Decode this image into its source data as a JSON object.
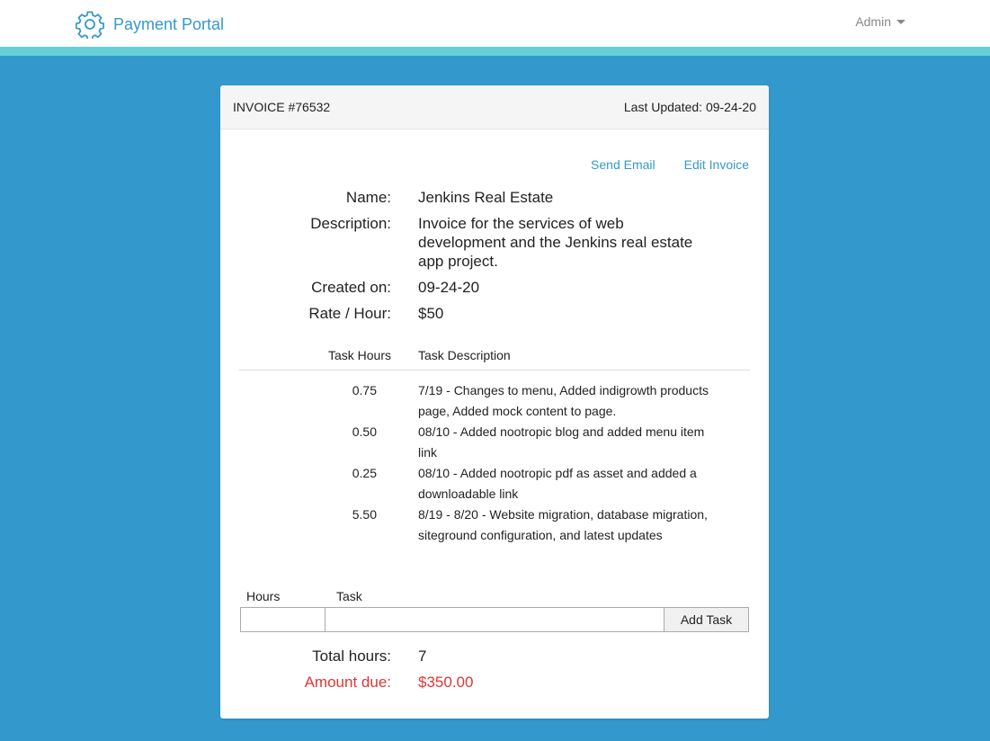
{
  "nav": {
    "brand": "Payment Portal",
    "user_menu": "Admin"
  },
  "invoice": {
    "number": "INVOICE #76532",
    "last_updated": "Last Updated: 09-24-20",
    "actions": {
      "send_email": "Send Email",
      "edit_invoice": "Edit Invoice"
    },
    "details": {
      "name_label": "Name:",
      "name_value": "Jenkins Real Estate",
      "description_label": "Description:",
      "description_value": "Invoice for the services of web development and the Jenkins real estate app project.",
      "created_label": "Created on:",
      "created_value": "09-24-20",
      "rate_label": "Rate / Hour:",
      "rate_value": "$50"
    },
    "tasks_header": {
      "hours": "Task Hours",
      "description": "Task Description"
    },
    "tasks": [
      {
        "hours": "0.75",
        "description": "7/19 - Changes to menu, Added indigrowth products page, Added mock content to page."
      },
      {
        "hours": "0.50",
        "description": "08/10 - Added nootropic blog and added menu item link"
      },
      {
        "hours": "0.25",
        "description": "08/10 - Added nootropic pdf as asset and added a downloadable link"
      },
      {
        "hours": "5.50",
        "description": "8/19 - 8/20 - Website migration, database migration, siteground configuration, and latest updates"
      }
    ],
    "new_task": {
      "hours_label": "Hours",
      "task_label": "Task",
      "hours_value": "",
      "task_value": "",
      "add_button": "Add Task"
    },
    "totals": {
      "hours_label": "Total hours:",
      "hours_value": "7",
      "due_label": "Amount due:",
      "due_value": "$350.00"
    }
  },
  "colors": {
    "background": "#3399cc",
    "accent_stripe": "#66d0d8",
    "link": "#3399cc",
    "amount_due": "#e03535"
  }
}
